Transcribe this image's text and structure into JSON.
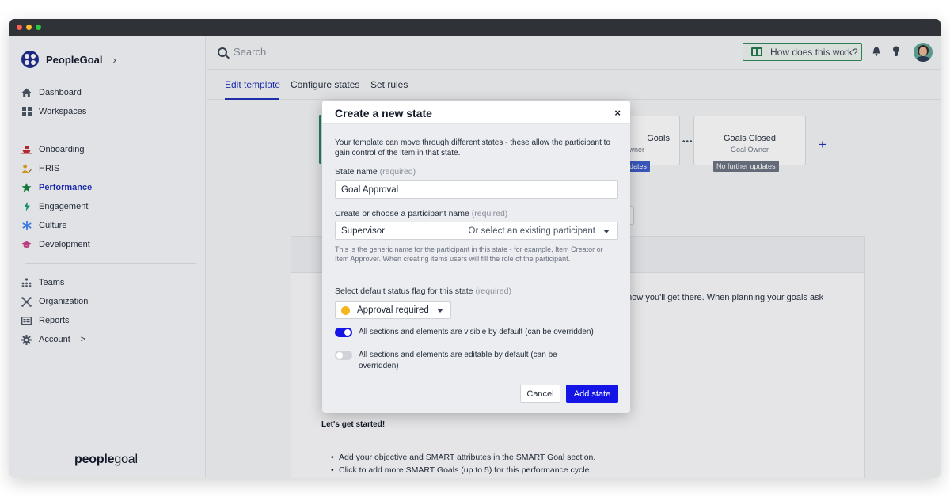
{
  "sidebar": {
    "brand": "PeopleGoal",
    "items": [
      {
        "label": "Dashboard",
        "icon": "house-icon"
      },
      {
        "label": "Workspaces",
        "icon": "grid-icon"
      },
      {
        "label": "Onboarding",
        "icon": "ship-icon"
      },
      {
        "label": "HRIS",
        "icon": "user-edit-icon"
      },
      {
        "label": "Performance",
        "icon": "star-icon"
      },
      {
        "label": "Engagement",
        "icon": "bolt-icon"
      },
      {
        "label": "Culture",
        "icon": "asterisk-icon"
      },
      {
        "label": "Development",
        "icon": "graduation-icon"
      },
      {
        "label": "Teams",
        "icon": "org-icon"
      },
      {
        "label": "Organization",
        "icon": "network-icon"
      },
      {
        "label": "Reports",
        "icon": "report-icon"
      },
      {
        "label": "Account",
        "icon": "gear-icon"
      }
    ],
    "account_chevron": ">",
    "footer_bold": "people",
    "footer_light": "goal"
  },
  "topbar": {
    "search_placeholder": "Search",
    "help_button": "How does this work?"
  },
  "tabs": [
    {
      "label": "Edit template"
    },
    {
      "label": "Configure states"
    },
    {
      "label": "Set rules"
    }
  ],
  "background": {
    "cards": [
      {
        "title": "Goals",
        "sub": "wner",
        "badge": "dates"
      },
      {
        "title": "Goals Closed",
        "sub": "Goal Owner",
        "badge": "No further updates"
      }
    ],
    "add_symbol": "+",
    "ellipsis": "•••",
    "description": "d how you'll get there. When planning your goals ask",
    "started": "Let's get started!",
    "bullets": [
      "Add your objective and SMART attributes in the SMART Goal section.",
      "Click to add more SMART Goals (up to 5) for this performance cycle."
    ]
  },
  "modal": {
    "title": "Create a new state",
    "close": "×",
    "intro": "Your template can move through different states - these allow the participant to gain control of the item in that state.",
    "state_name_label": "State name",
    "required": "(required)",
    "state_name_value": "Goal Approval",
    "participant_label": "Create or choose a participant name",
    "participant_value": "Supervisor",
    "participant_select": "Or select an existing participant",
    "help_text": "This is the generic name for the participant in this state - for example, Item Creator or Item Approver. When creating items users will fill the role of the participant.",
    "flag_label": "Select default status flag for this state",
    "flag_value": "Approval required",
    "toggle_visible": "All sections and elements are visible by default (can be overridden)",
    "toggle_visible_on": true,
    "toggle_editable": "All sections and elements are editable by default (can be overridden)",
    "toggle_editable_on": false,
    "cancel": "Cancel",
    "submit": "Add state"
  },
  "colors": {
    "accent": "#1d2fb8",
    "primary_button": "#1414e6",
    "flag_dot": "#f3b61f",
    "help_border": "#2e8a5a",
    "card_accent": "#1b8a6b"
  }
}
